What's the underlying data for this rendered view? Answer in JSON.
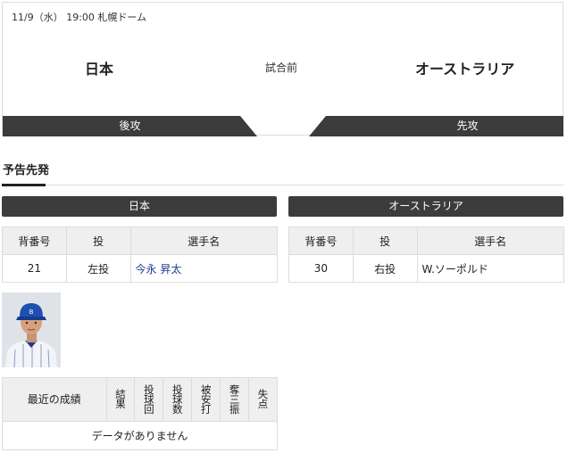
{
  "game": {
    "info": "11/9（水） 19:00 札幌ドーム",
    "home_team": "日本",
    "away_team": "オーストラリア",
    "status": "試合前",
    "home_order": "後攻",
    "away_order": "先攻"
  },
  "probable_pitchers": {
    "title": "予告先発",
    "columns": [
      "背番号",
      "投",
      "選手名"
    ],
    "home": {
      "team": "日本",
      "number": "21",
      "throws": "左投",
      "name": "今永 昇太"
    },
    "away": {
      "team": "オーストラリア",
      "number": "30",
      "throws": "右投",
      "name": "W.ソーポルド"
    }
  },
  "recent_results": {
    "columns": [
      "最近の成績",
      "結果",
      "投球回",
      "投球数",
      "被安打",
      "奪三振",
      "失点"
    ],
    "empty_message": "データがありません"
  },
  "colors": {
    "dark_bar": "#3c3c3c",
    "link": "#1a3d8f",
    "table_header_bg": "#efefef",
    "border": "#dcdcdc"
  }
}
